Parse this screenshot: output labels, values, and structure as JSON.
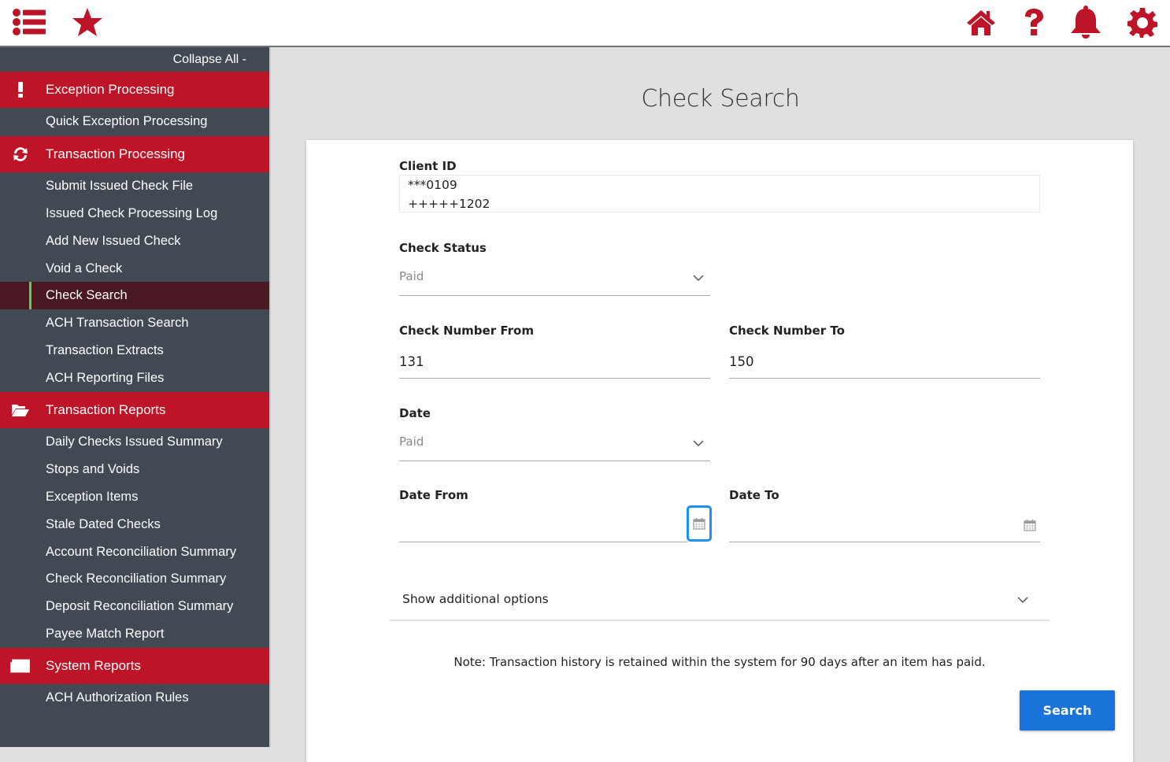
{
  "topbar": {
    "left_icons": [
      {
        "name": "menu-list-icon",
        "label": "Menu"
      },
      {
        "name": "favorites-star-icon",
        "label": "Favorites"
      }
    ],
    "right_icons": [
      {
        "name": "home-icon",
        "label": "Home"
      },
      {
        "name": "help-icon",
        "label": "Help"
      },
      {
        "name": "notifications-bell-icon",
        "label": "Notifications"
      },
      {
        "name": "settings-gear-icon",
        "label": "Settings"
      }
    ],
    "accent_color": "#bd1427"
  },
  "sidebar": {
    "collapse_label": "Collapse All -",
    "groups": [
      {
        "label": "Exception Processing",
        "icon": "exclamation-icon",
        "items": [
          {
            "label": "Quick Exception Processing"
          }
        ]
      },
      {
        "label": "Transaction Processing",
        "icon": "refresh-icon",
        "items": [
          {
            "label": "Submit Issued Check File"
          },
          {
            "label": "Issued Check Processing Log"
          },
          {
            "label": "Add New Issued Check"
          },
          {
            "label": "Void a Check"
          },
          {
            "label": "Check Search",
            "active": true
          },
          {
            "label": "ACH Transaction Search"
          },
          {
            "label": "Transaction Extracts"
          },
          {
            "label": "ACH Reporting Files"
          }
        ]
      },
      {
        "label": "Transaction Reports",
        "icon": "folder-open-icon",
        "items": [
          {
            "label": "Daily Checks Issued Summary"
          },
          {
            "label": "Stops and Voids"
          },
          {
            "label": "Exception Items"
          },
          {
            "label": "Stale Dated Checks"
          },
          {
            "label": "Account Reconciliation Summary"
          },
          {
            "label": "Check Reconciliation Summary"
          },
          {
            "label": "Deposit Reconciliation Summary"
          },
          {
            "label": "Payee Match Report"
          }
        ]
      },
      {
        "label": "System Reports",
        "icon": "newspaper-icon",
        "items": [
          {
            "label": "ACH Authorization Rules"
          }
        ]
      }
    ]
  },
  "main": {
    "title": "Check Search",
    "form": {
      "client_id": {
        "label": "Client ID",
        "options": [
          "***0109",
          "+++++1202"
        ]
      },
      "check_status": {
        "label": "Check Status",
        "value": "Paid"
      },
      "check_number_from": {
        "label": "Check Number From",
        "value": "131"
      },
      "check_number_to": {
        "label": "Check Number To",
        "value": "150"
      },
      "date": {
        "label": "Date",
        "value": "Paid"
      },
      "date_from": {
        "label": "Date From",
        "value": ""
      },
      "date_to": {
        "label": "Date To",
        "value": ""
      },
      "additional_options_label": "Show additional options",
      "note": "Note: Transaction history is retained within the system for 90 days after an item has paid.",
      "search_label": "Search"
    },
    "colors": {
      "primary_button": "#1a73d9",
      "focus_ring": "#1e8ff5"
    }
  }
}
